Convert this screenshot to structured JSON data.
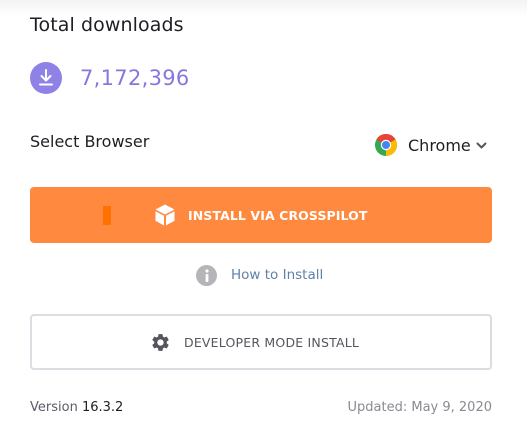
{
  "downloads": {
    "title": "Total downloads",
    "count": "7,172,396",
    "icon": "download-icon"
  },
  "browser": {
    "label": "Select Browser",
    "selected": "Chrome",
    "icon": "chrome-icon"
  },
  "install_button": {
    "label": "INSTALL VIA CROSSPILOT",
    "icon": "cube-icon"
  },
  "how_to": {
    "label": "How to Install",
    "icon": "info-icon"
  },
  "dev_button": {
    "label": "DEVELOPER MODE INSTALL",
    "icon": "gear-icon"
  },
  "footer": {
    "version_label": "Version",
    "version_number": "16.3.2",
    "updated": "Updated: May 9, 2020"
  },
  "colors": {
    "accent_purple": "#8577df",
    "install_orange": "#ff8a3f",
    "link_blue": "#5f82a8"
  }
}
